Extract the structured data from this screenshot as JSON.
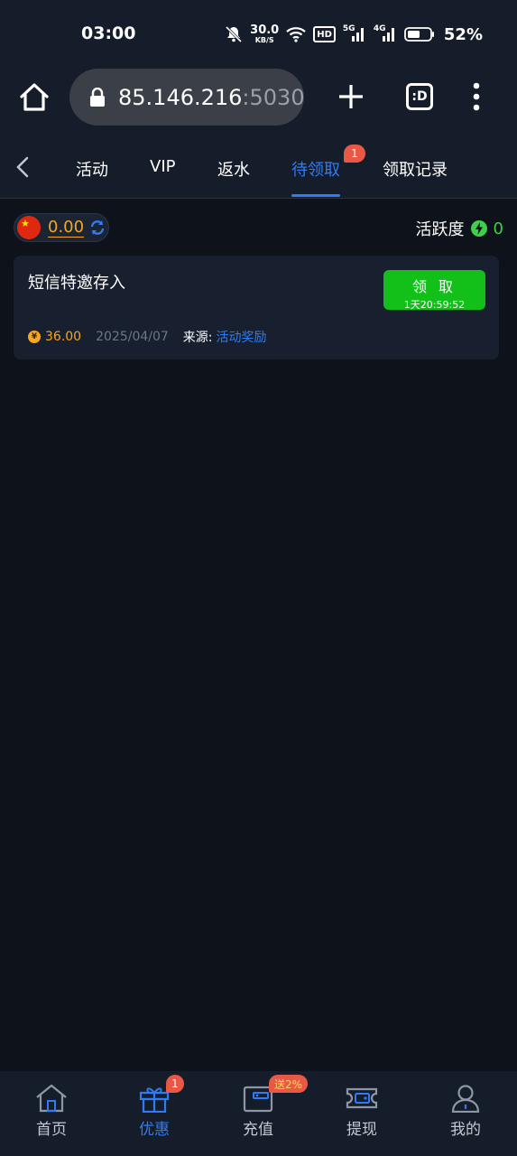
{
  "status_bar": {
    "time": "03:00",
    "net_speed_value": "30.0",
    "net_speed_unit": "KB/S",
    "hd_label": "HD",
    "sim1_label": "5G",
    "sim2_label": "4G",
    "battery_percent": "52%",
    "icons": [
      "mute-bell-icon",
      "wifi-icon",
      "hd-icon",
      "signal-5g-icon",
      "signal-4g-icon",
      "battery-icon"
    ]
  },
  "browser": {
    "url_host": "85.146.216",
    "url_port": ":5030",
    "tabs_label": ":D",
    "icons": [
      "home-icon",
      "lock-icon",
      "plus-icon",
      "more-vertical-icon"
    ]
  },
  "nav_tabs": {
    "items": [
      {
        "label": "活动"
      },
      {
        "label": "VIP"
      },
      {
        "label": "返水"
      },
      {
        "label": "待领取",
        "active": true,
        "badge": "1"
      },
      {
        "label": "领取记录"
      }
    ],
    "accent_color": "#2f7bf5"
  },
  "wallet": {
    "balance": "0.00",
    "activity_label": "活跃度",
    "activity_value": "0"
  },
  "reward": {
    "title": "短信特邀存入",
    "claim_label": "领 取",
    "claim_timer": "1天20:59:52",
    "amount": "36.00",
    "coin_symbol": "¥",
    "date": "2025/04/07",
    "source_label": "来源:",
    "source_value": "活动奖励"
  },
  "bottom_nav": {
    "items": [
      {
        "label": "首页",
        "icon": "home-icon"
      },
      {
        "label": "优惠",
        "icon": "gift-icon",
        "active": true,
        "badge": "1"
      },
      {
        "label": "充值",
        "icon": "wallet-icon",
        "badge": "送2%"
      },
      {
        "label": "提现",
        "icon": "withdraw-icon"
      },
      {
        "label": "我的",
        "icon": "user-icon"
      }
    ]
  }
}
